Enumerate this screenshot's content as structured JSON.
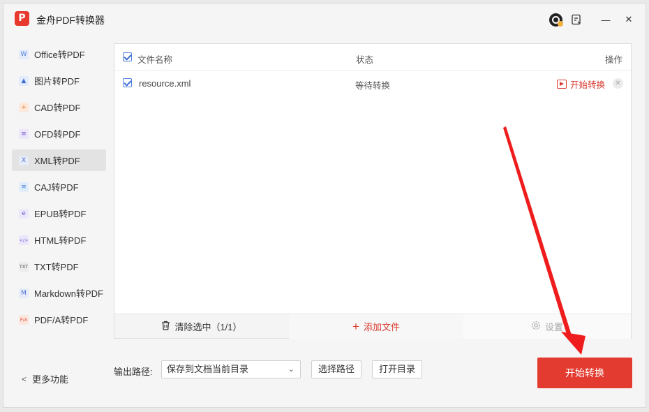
{
  "app": {
    "logo_glyph": "P",
    "title": "金舟PDF转换器"
  },
  "titlebar": {
    "avatar_icon": "user-avatar-icon",
    "feedback_icon": "feedback-icon",
    "minimize_glyph": "—",
    "close_glyph": "✕"
  },
  "sidebar": {
    "items": [
      {
        "label": "Office转PDF",
        "icon": "W",
        "icon_color": "#4a7cdc",
        "icon_bg": "#e4ecfb"
      },
      {
        "label": "图片转PDF",
        "icon": "▲",
        "icon_color": "#3f6fd1",
        "icon_bg": "#e4ecfb"
      },
      {
        "label": "CAD转PDF",
        "icon": "+",
        "icon_color": "#f07a2a",
        "icon_bg": "#fde9dc"
      },
      {
        "label": "OFD转PDF",
        "icon": "≡",
        "icon_color": "#7a5bd6",
        "icon_bg": "#ece6fb"
      },
      {
        "label": "XML转PDF",
        "icon": "X",
        "icon_color": "#4a6fd1",
        "icon_bg": "#e6ebf8"
      },
      {
        "label": "CAJ转PDF",
        "icon": "≡",
        "icon_color": "#3f7fd8",
        "icon_bg": "#e2edfb"
      },
      {
        "label": "EPUB转PDF",
        "icon": "e",
        "icon_color": "#6a5ad8",
        "icon_bg": "#ebe8fb"
      },
      {
        "label": "HTML转PDF",
        "icon": "</>",
        "icon_color": "#7a5bd6",
        "icon_bg": "#ece6fb"
      },
      {
        "label": "TXT转PDF",
        "icon": "TXT",
        "icon_color": "#444444",
        "icon_bg": "#ececec"
      },
      {
        "label": "Markdown转PDF",
        "icon": "M",
        "icon_color": "#4a6fd1",
        "icon_bg": "#e6ebf8"
      },
      {
        "label": "PDF/A转PDF",
        "icon": "P/A",
        "icon_color": "#e0593a",
        "icon_bg": "#fde6df"
      }
    ],
    "active_index": 4,
    "more_label": "更多功能",
    "more_glyph": "<"
  },
  "table": {
    "headers": {
      "name": "文件名称",
      "status": "状态",
      "operation": "操作"
    },
    "rows": [
      {
        "name": "resource.xml",
        "status": "等待转换",
        "action": "开始转换"
      }
    ],
    "remove_glyph": "✕"
  },
  "footer": {
    "clear_label": "清除选中（1/1）",
    "clear_icon": "trash-icon",
    "add_label": "添加文件",
    "add_glyph": "+",
    "settings_label": "设置",
    "settings_icon": "gear-icon"
  },
  "output": {
    "label": "输出路径:",
    "selected": "保存到文档当前目录",
    "choose_path": "选择路径",
    "open_dir": "打开目录",
    "caret": "⌄"
  },
  "start_button": "开始转换",
  "colors": {
    "accent": "#e33b30",
    "checkbox": "#3c6fd6"
  }
}
